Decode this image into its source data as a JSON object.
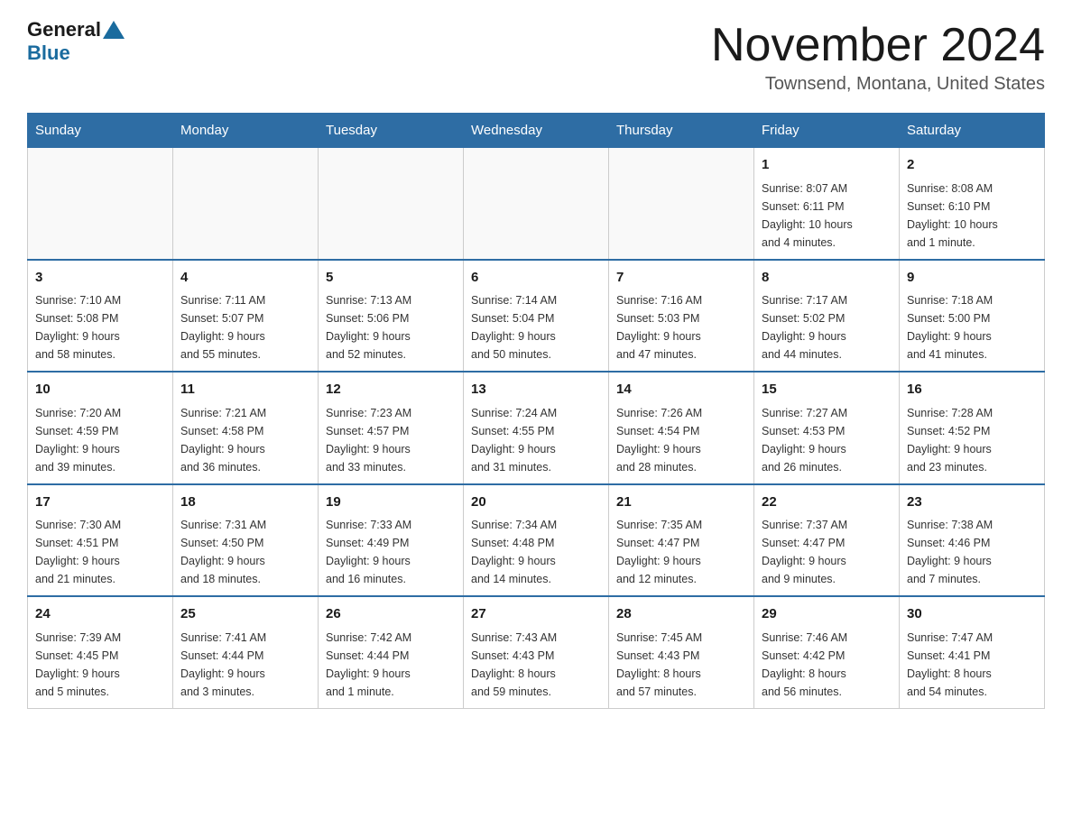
{
  "header": {
    "logo_general": "General",
    "logo_blue": "Blue",
    "month_title": "November 2024",
    "location": "Townsend, Montana, United States"
  },
  "weekdays": [
    "Sunday",
    "Monday",
    "Tuesday",
    "Wednesday",
    "Thursday",
    "Friday",
    "Saturday"
  ],
  "weeks": [
    [
      {
        "day": "",
        "info": ""
      },
      {
        "day": "",
        "info": ""
      },
      {
        "day": "",
        "info": ""
      },
      {
        "day": "",
        "info": ""
      },
      {
        "day": "",
        "info": ""
      },
      {
        "day": "1",
        "info": "Sunrise: 8:07 AM\nSunset: 6:11 PM\nDaylight: 10 hours\nand 4 minutes."
      },
      {
        "day": "2",
        "info": "Sunrise: 8:08 AM\nSunset: 6:10 PM\nDaylight: 10 hours\nand 1 minute."
      }
    ],
    [
      {
        "day": "3",
        "info": "Sunrise: 7:10 AM\nSunset: 5:08 PM\nDaylight: 9 hours\nand 58 minutes."
      },
      {
        "day": "4",
        "info": "Sunrise: 7:11 AM\nSunset: 5:07 PM\nDaylight: 9 hours\nand 55 minutes."
      },
      {
        "day": "5",
        "info": "Sunrise: 7:13 AM\nSunset: 5:06 PM\nDaylight: 9 hours\nand 52 minutes."
      },
      {
        "day": "6",
        "info": "Sunrise: 7:14 AM\nSunset: 5:04 PM\nDaylight: 9 hours\nand 50 minutes."
      },
      {
        "day": "7",
        "info": "Sunrise: 7:16 AM\nSunset: 5:03 PM\nDaylight: 9 hours\nand 47 minutes."
      },
      {
        "day": "8",
        "info": "Sunrise: 7:17 AM\nSunset: 5:02 PM\nDaylight: 9 hours\nand 44 minutes."
      },
      {
        "day": "9",
        "info": "Sunrise: 7:18 AM\nSunset: 5:00 PM\nDaylight: 9 hours\nand 41 minutes."
      }
    ],
    [
      {
        "day": "10",
        "info": "Sunrise: 7:20 AM\nSunset: 4:59 PM\nDaylight: 9 hours\nand 39 minutes."
      },
      {
        "day": "11",
        "info": "Sunrise: 7:21 AM\nSunset: 4:58 PM\nDaylight: 9 hours\nand 36 minutes."
      },
      {
        "day": "12",
        "info": "Sunrise: 7:23 AM\nSunset: 4:57 PM\nDaylight: 9 hours\nand 33 minutes."
      },
      {
        "day": "13",
        "info": "Sunrise: 7:24 AM\nSunset: 4:55 PM\nDaylight: 9 hours\nand 31 minutes."
      },
      {
        "day": "14",
        "info": "Sunrise: 7:26 AM\nSunset: 4:54 PM\nDaylight: 9 hours\nand 28 minutes."
      },
      {
        "day": "15",
        "info": "Sunrise: 7:27 AM\nSunset: 4:53 PM\nDaylight: 9 hours\nand 26 minutes."
      },
      {
        "day": "16",
        "info": "Sunrise: 7:28 AM\nSunset: 4:52 PM\nDaylight: 9 hours\nand 23 minutes."
      }
    ],
    [
      {
        "day": "17",
        "info": "Sunrise: 7:30 AM\nSunset: 4:51 PM\nDaylight: 9 hours\nand 21 minutes."
      },
      {
        "day": "18",
        "info": "Sunrise: 7:31 AM\nSunset: 4:50 PM\nDaylight: 9 hours\nand 18 minutes."
      },
      {
        "day": "19",
        "info": "Sunrise: 7:33 AM\nSunset: 4:49 PM\nDaylight: 9 hours\nand 16 minutes."
      },
      {
        "day": "20",
        "info": "Sunrise: 7:34 AM\nSunset: 4:48 PM\nDaylight: 9 hours\nand 14 minutes."
      },
      {
        "day": "21",
        "info": "Sunrise: 7:35 AM\nSunset: 4:47 PM\nDaylight: 9 hours\nand 12 minutes."
      },
      {
        "day": "22",
        "info": "Sunrise: 7:37 AM\nSunset: 4:47 PM\nDaylight: 9 hours\nand 9 minutes."
      },
      {
        "day": "23",
        "info": "Sunrise: 7:38 AM\nSunset: 4:46 PM\nDaylight: 9 hours\nand 7 minutes."
      }
    ],
    [
      {
        "day": "24",
        "info": "Sunrise: 7:39 AM\nSunset: 4:45 PM\nDaylight: 9 hours\nand 5 minutes."
      },
      {
        "day": "25",
        "info": "Sunrise: 7:41 AM\nSunset: 4:44 PM\nDaylight: 9 hours\nand 3 minutes."
      },
      {
        "day": "26",
        "info": "Sunrise: 7:42 AM\nSunset: 4:44 PM\nDaylight: 9 hours\nand 1 minute."
      },
      {
        "day": "27",
        "info": "Sunrise: 7:43 AM\nSunset: 4:43 PM\nDaylight: 8 hours\nand 59 minutes."
      },
      {
        "day": "28",
        "info": "Sunrise: 7:45 AM\nSunset: 4:43 PM\nDaylight: 8 hours\nand 57 minutes."
      },
      {
        "day": "29",
        "info": "Sunrise: 7:46 AM\nSunset: 4:42 PM\nDaylight: 8 hours\nand 56 minutes."
      },
      {
        "day": "30",
        "info": "Sunrise: 7:47 AM\nSunset: 4:41 PM\nDaylight: 8 hours\nand 54 minutes."
      }
    ]
  ]
}
